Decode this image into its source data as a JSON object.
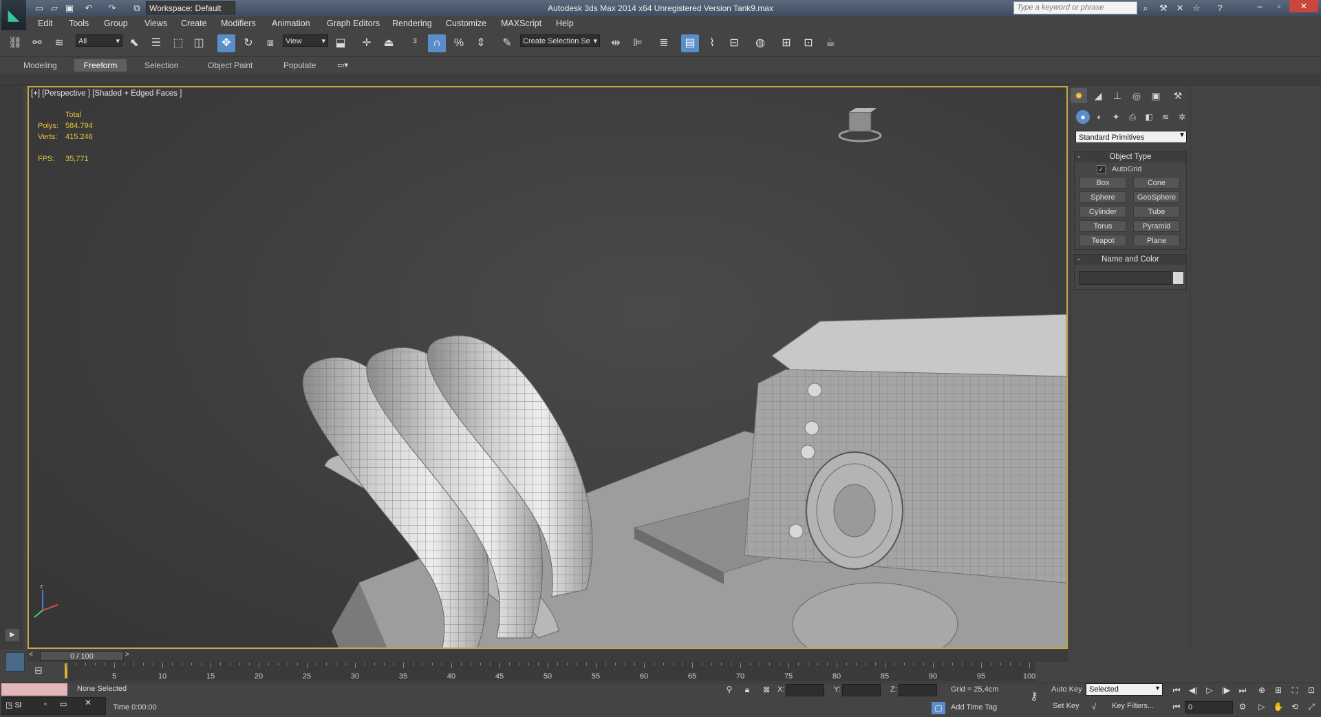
{
  "window": {
    "workspace": "Workspace: Default",
    "title": "Autodesk 3ds Max  2014 x64    Unregistered Version    Tank9.max",
    "search_placeholder": "Type a keyword or phrase"
  },
  "menu": [
    "Edit",
    "Tools",
    "Group",
    "Views",
    "Create",
    "Modifiers",
    "Animation",
    "Graph Editors",
    "Rendering",
    "Customize",
    "MAXScript",
    "Help"
  ],
  "toolbar": {
    "selection_filter": "All",
    "ref_coord": "View",
    "named_selection": "Create Selection Se"
  },
  "ribbon": {
    "tabs": [
      "Modeling",
      "Freeform",
      "Selection",
      "Object Paint",
      "Populate"
    ],
    "active_tab": "Freeform"
  },
  "viewport": {
    "label": "[+] [Perspective ] [Shaded + Edged Faces ]",
    "stats": {
      "total_label": "Total",
      "polys_label": "Polys:",
      "polys_value": "584.794",
      "verts_label": "Verts:",
      "verts_value": "415.246",
      "fps_label": "FPS:",
      "fps_value": "35,771"
    }
  },
  "command_panel": {
    "category": "Standard Primitives",
    "object_type": {
      "title": "Object Type",
      "autogrid": "AutoGrid",
      "buttons": [
        "Box",
        "Cone",
        "Sphere",
        "GeoSphere",
        "Cylinder",
        "Tube",
        "Torus",
        "Pyramid",
        "Teapot",
        "Plane"
      ]
    },
    "name_color": {
      "title": "Name and Color"
    }
  },
  "timeline": {
    "slider": "0 / 100",
    "ticks": [
      "5",
      "10",
      "15",
      "20",
      "25",
      "30",
      "35",
      "40",
      "45",
      "50",
      "55",
      "60",
      "65",
      "70",
      "75",
      "80",
      "85",
      "90",
      "95",
      "100"
    ]
  },
  "status": {
    "script_listener": "Sl",
    "selection": "None Selected",
    "time": "Time  0:00:00",
    "x_label": "X:",
    "y_label": "Y:",
    "z_label": "Z:",
    "grid": "Grid = 25,4cm",
    "add_time_tag": "Add Time Tag",
    "auto_key": "Auto Key",
    "set_key": "Set Key",
    "key_mode": "Selected",
    "key_filters": "Key Filters...",
    "frame": "0"
  },
  "colors": {
    "accent": "#5b8ec9",
    "viewport_border": "#c9a645",
    "stats": "#e6c33a"
  }
}
